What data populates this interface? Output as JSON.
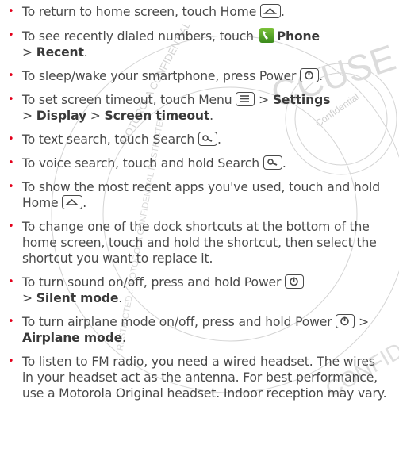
{
  "watermark": {
    "line1": "MOTOROLA CONFIDENTIAL",
    "line2": "RESTRICTED :: MOTOROLA CONFIDENTIAL RESTRICTED",
    "ring_text": "CONFIDENTIAL",
    "stamp_text": "Confidential",
    "big_text": "CCUSE"
  },
  "items": [
    {
      "parts": [
        "To return to home screen, touch Home",
        "."
      ]
    },
    {
      "parts": [
        "To see recently dialed numbers, touch",
        "Phone",
        ">",
        "Recent",
        "."
      ]
    },
    {
      "parts": [
        "To sleep/wake your smartphone, press Power",
        "."
      ]
    },
    {
      "parts": [
        "To set screen timeout, touch Menu",
        ">",
        "Settings",
        ">",
        "Display",
        ">",
        "Screen timeout",
        "."
      ]
    },
    {
      "parts": [
        "To text search, touch Search",
        "."
      ]
    },
    {
      "parts": [
        "To voice search, touch and hold Search",
        "."
      ]
    },
    {
      "parts": [
        "To show the most recent apps you've used, touch and hold Home",
        "."
      ]
    },
    {
      "parts": [
        "To change one of the dock shortcuts at the bottom of the home screen, touch and hold the shortcut, then select the shortcut you want to replace it."
      ]
    },
    {
      "parts": [
        "To turn sound on/off, press and hold Power",
        ">",
        "Silent mode",
        "."
      ]
    },
    {
      "parts": [
        "To turn airplane mode on/off, press and hold Power",
        ">",
        "Airplane mode",
        "."
      ]
    },
    {
      "parts": [
        "To listen to FM radio, you need a wired headset. The wires in your headset act as the antenna. For best performance, use a Motorola Original headset. Indoor reception may vary."
      ]
    }
  ],
  "bullet": "•",
  "colors": {
    "bullet": "#e3001b",
    "text": "#4a4a4a",
    "watermark": "#c8c8c8",
    "phone_icon": "#4fa52a"
  },
  "icons": [
    "home-key-icon",
    "phone-app-icon",
    "power-key-icon",
    "menu-key-icon",
    "search-key-icon"
  ]
}
